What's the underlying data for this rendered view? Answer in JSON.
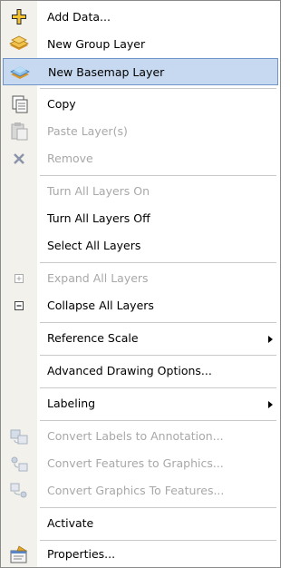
{
  "menu": {
    "items": [
      {
        "label": "Add Data...",
        "icon": "add-data-icon"
      },
      {
        "label": "New Group Layer",
        "icon": "group-layer-icon"
      },
      {
        "label": "New Basemap Layer",
        "icon": "basemap-layer-icon"
      },
      {
        "label": "Copy",
        "icon": "copy-icon"
      },
      {
        "label": "Paste Layer(s)",
        "icon": "paste-icon"
      },
      {
        "label": "Remove",
        "icon": "remove-icon"
      },
      {
        "label": "Turn All Layers On"
      },
      {
        "label": "Turn All Layers Off"
      },
      {
        "label": "Select All Layers"
      },
      {
        "label": "Expand All Layers",
        "icon": "expand-icon"
      },
      {
        "label": "Collapse All Layers",
        "icon": "collapse-icon"
      },
      {
        "label": "Reference Scale",
        "submenu": true
      },
      {
        "label": "Advanced Drawing Options..."
      },
      {
        "label": "Labeling",
        "submenu": true
      },
      {
        "label": "Convert Labels to Annotation...",
        "icon": "convert-labels-icon"
      },
      {
        "label": "Convert Features to Graphics...",
        "icon": "features-to-graphics-icon"
      },
      {
        "label": "Convert Graphics To Features...",
        "icon": "graphics-to-features-icon"
      },
      {
        "label": "Activate"
      },
      {
        "label": "Properties...",
        "icon": "properties-icon"
      }
    ]
  },
  "colors": {
    "highlight": "#c7d9f0",
    "disabled_text": "#a8a8a8",
    "gutter": "#f2f1ec"
  }
}
